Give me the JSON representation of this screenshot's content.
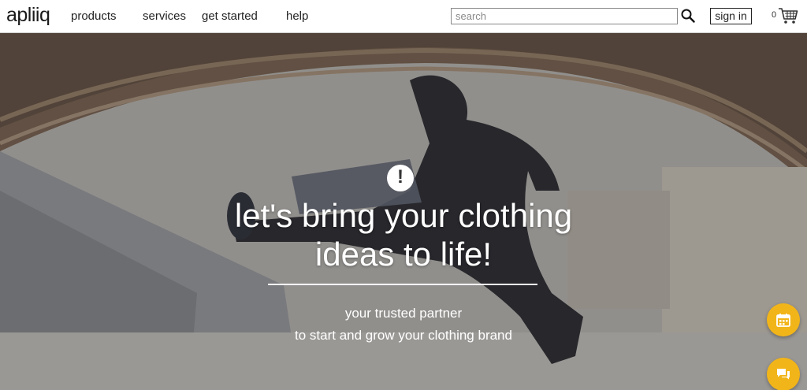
{
  "brand": {
    "logo_text": "apliiq"
  },
  "nav": {
    "links": [
      {
        "label": "products"
      },
      {
        "label": "services"
      },
      {
        "label": "get started"
      },
      {
        "label": "help"
      }
    ],
    "search": {
      "placeholder": "search",
      "value": ""
    },
    "signin_label": "sign in",
    "cart_count": "0"
  },
  "hero": {
    "badge_glyph": "!",
    "headline_line1": "let's bring your clothing",
    "headline_line2": "ideas to life!",
    "subtitle_line1": "your trusted partner",
    "subtitle_line2": "to start and grow your clothing brand"
  },
  "icons": {
    "search": "search-icon",
    "cart": "cart-icon",
    "calendar": "calendar-icon",
    "chat": "chat-icon",
    "alert": "exclamation-icon"
  },
  "colors": {
    "accent": "#f2b519",
    "text": "#222222",
    "hero_text": "#ffffff"
  }
}
